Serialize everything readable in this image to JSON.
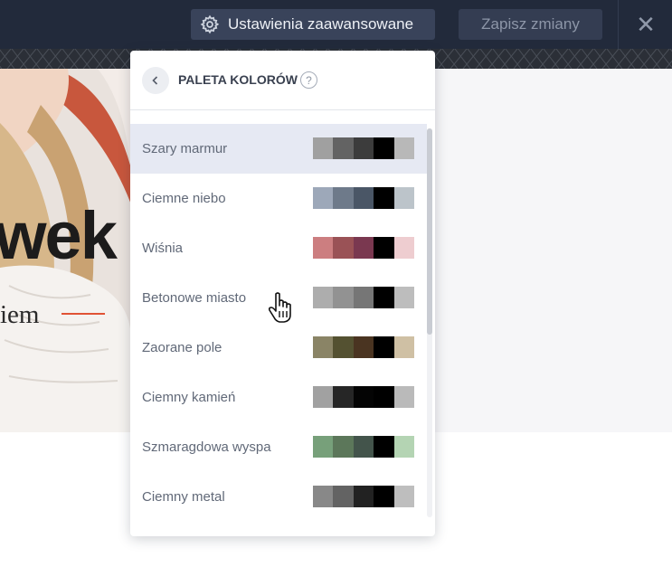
{
  "topbar": {
    "advanced_settings_label": "Ustawienia zaawansowane",
    "save_label": "Zapisz zmiany",
    "close_glyph": "✕"
  },
  "preview": {
    "hero_text": "wek",
    "sub_text": "iem",
    "accent_color": "#e05234"
  },
  "palette_panel": {
    "title": "PALETA KOLORÓW",
    "help_glyph": "?",
    "selected_index": 0,
    "palettes": [
      {
        "name": "Szary marmur",
        "colors": [
          "#a0a0a0",
          "#636363",
          "#3c3c3c",
          "#000000",
          "#b8b8b8"
        ]
      },
      {
        "name": "Ciemne niebo",
        "colors": [
          "#9da8b9",
          "#6e7a8a",
          "#4a5666",
          "#000000",
          "#bcc4ca"
        ]
      },
      {
        "name": "Wiśnia",
        "colors": [
          "#cc7e80",
          "#9a5256",
          "#7a3850",
          "#000000",
          "#eecdd0"
        ]
      },
      {
        "name": "Betonowe miasto",
        "colors": [
          "#adadad",
          "#929292",
          "#767676",
          "#000000",
          "#bdbdbd"
        ]
      },
      {
        "name": "Zaorane pole",
        "colors": [
          "#8a8466",
          "#545131",
          "#4a3421",
          "#000000",
          "#cfc0a4"
        ]
      },
      {
        "name": "Ciemny kamień",
        "colors": [
          "#a1a1a1",
          "#262626",
          "#040404",
          "#000000",
          "#bababa"
        ]
      },
      {
        "name": "Szmaragdowa wyspa",
        "colors": [
          "#77a07a",
          "#5c775a",
          "#43544b",
          "#000000",
          "#b4d4b3"
        ]
      },
      {
        "name": "Ciemny metal",
        "colors": [
          "#888888",
          "#636363",
          "#222222",
          "#000000",
          "#bebebe"
        ]
      }
    ]
  }
}
